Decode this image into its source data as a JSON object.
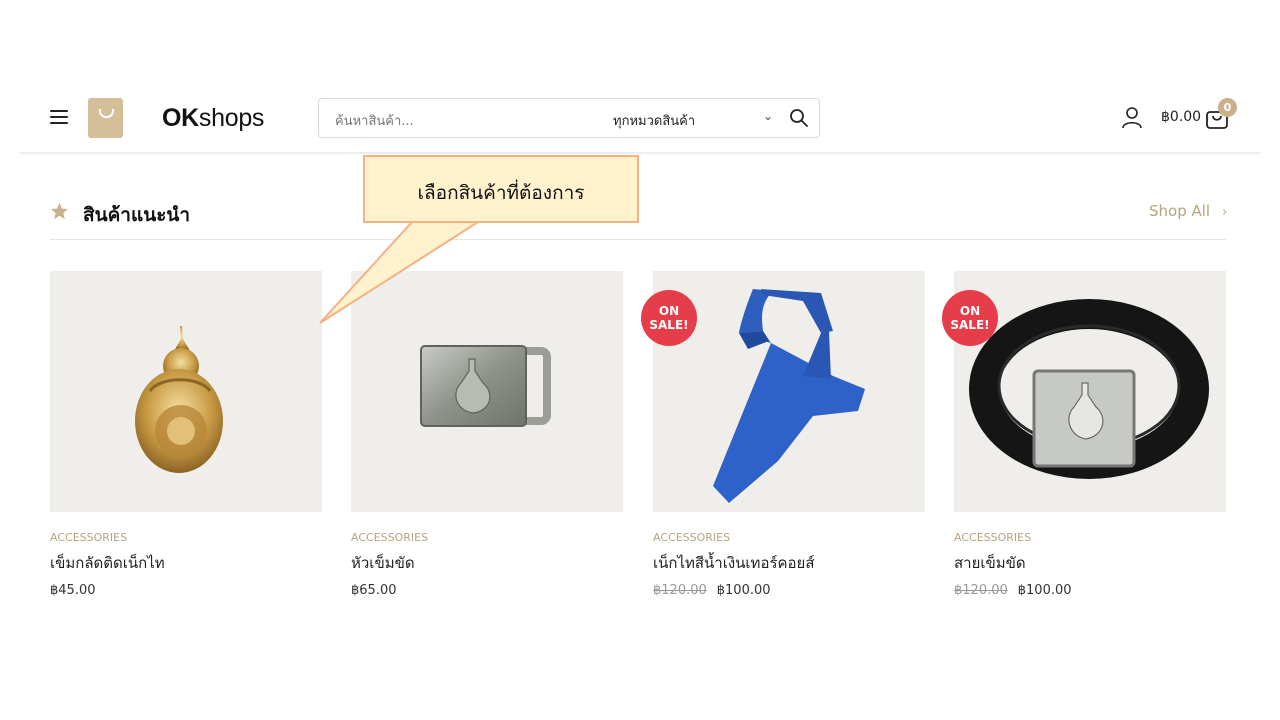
{
  "header": {
    "logo_bold": "OK",
    "logo_rest": "shops",
    "search_placeholder": "ค้นหาสินค้า...",
    "category_select": "ทุกหมวดสินค้า",
    "cart_total": "฿0.00",
    "cart_count": "0"
  },
  "section": {
    "title": "สินค้าแนะนำ",
    "shop_all": "Shop All"
  },
  "callout": {
    "text": "เลือกสินค้าที่ต้องการ"
  },
  "products": [
    {
      "category": "ACCESSORIES",
      "name": "เข็มกลัดติดเน็กไท",
      "old_price": "",
      "price": "฿45.00",
      "sale": false
    },
    {
      "category": "ACCESSORIES",
      "name": "หัวเข็มขัด",
      "old_price": "",
      "price": "฿65.00",
      "sale": false
    },
    {
      "category": "ACCESSORIES",
      "name": "เน็กไทสีน้ำเงินเทอร์คอยส์",
      "old_price": "฿120.00",
      "price": "฿100.00",
      "sale": true,
      "sale_line1": "ON",
      "sale_line2": "SALE!"
    },
    {
      "category": "ACCESSORIES",
      "name": "สายเข็มขัด",
      "old_price": "฿120.00",
      "price": "฿100.00",
      "sale": true,
      "sale_line1": "ON",
      "sale_line2": "SALE!"
    }
  ],
  "colors": {
    "accent": "#c8b08a",
    "sale": "#e53d49",
    "callout_fill": "#fff2cc",
    "callout_border": "#f4b183"
  },
  "icons": [
    "menu-icon",
    "shopping-bag-logo-icon",
    "search-icon",
    "chevron-down-icon",
    "user-icon",
    "cart-icon",
    "star-icon",
    "chevron-right-icon"
  ]
}
